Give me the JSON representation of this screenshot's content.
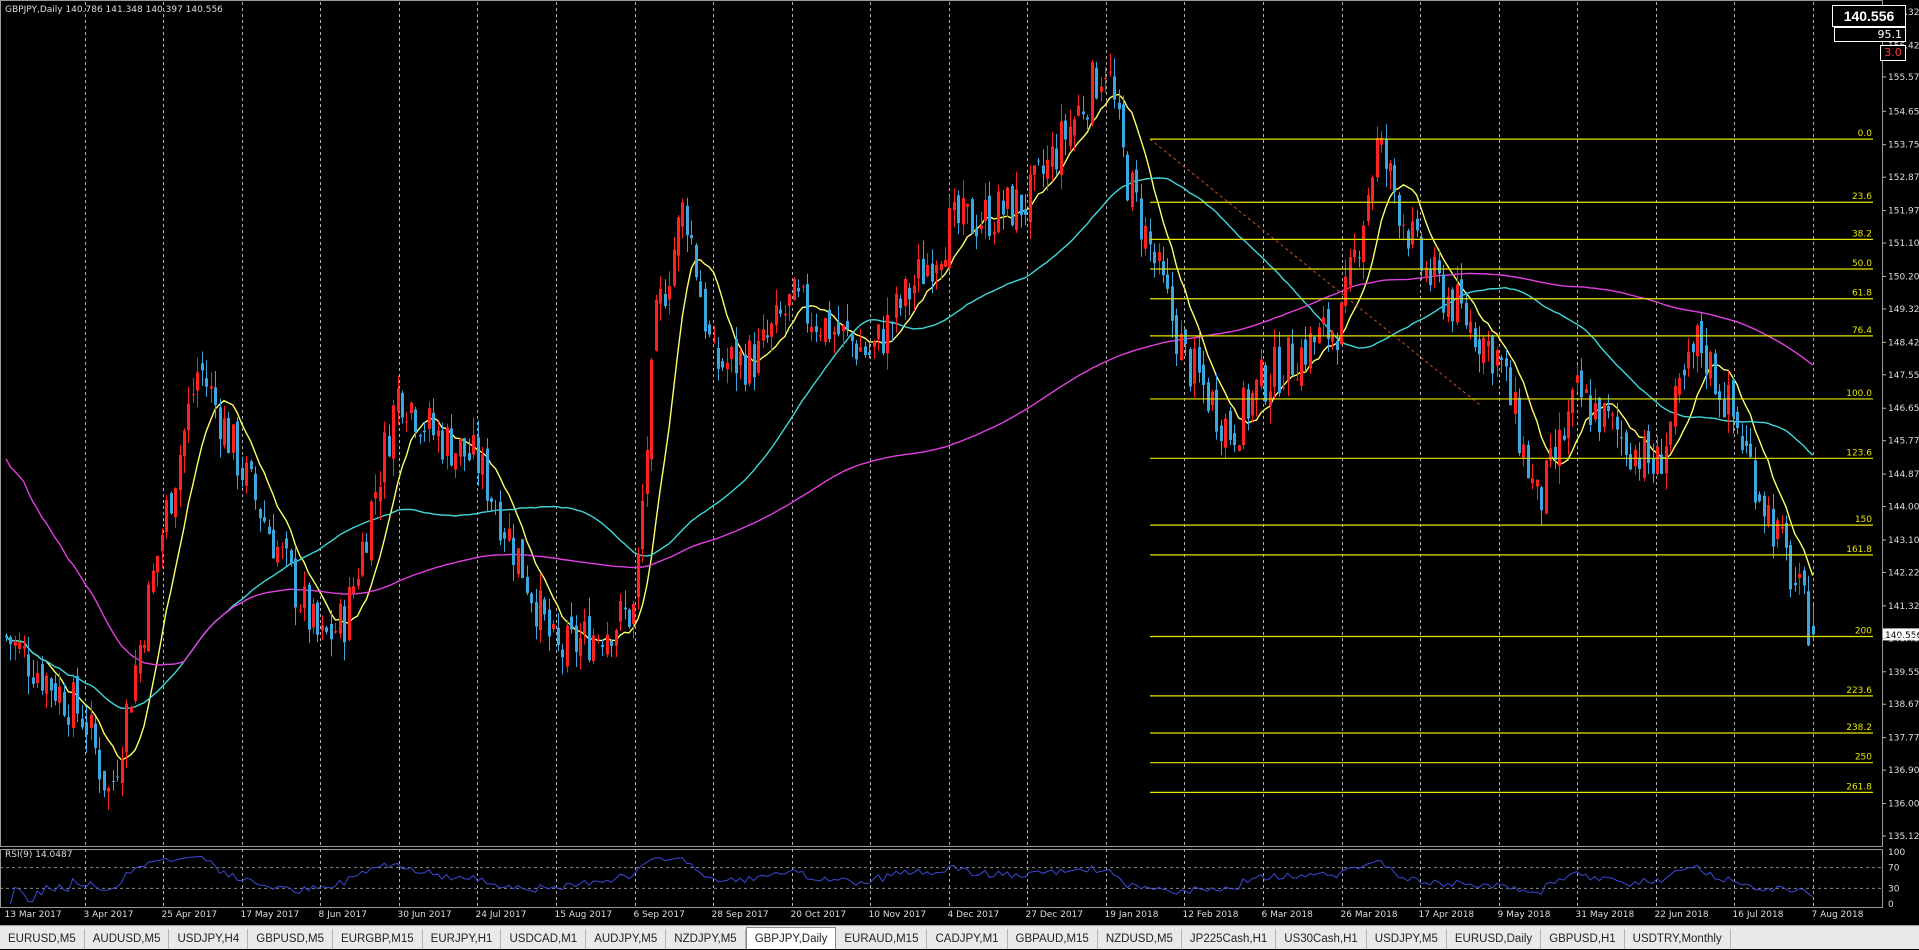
{
  "chart_header": {
    "text": "GBPJPY,Daily  140.786 141.348 140.397 140.556"
  },
  "rsi_header": {
    "text": "RSI(9) 14.0487"
  },
  "price_box": {
    "bid": "140.556",
    "spread": "95.1",
    "drawdown": "3.0"
  },
  "tabs": [
    {
      "label": "EURUSD,M5"
    },
    {
      "label": "AUDUSD,M5"
    },
    {
      "label": "USDJPY,H4"
    },
    {
      "label": "GBPUSD,M5"
    },
    {
      "label": "EURGBP,M15"
    },
    {
      "label": "EURJPY,H1"
    },
    {
      "label": "USDCAD,M1"
    },
    {
      "label": "AUDJPY,M5"
    },
    {
      "label": "NZDJPY,M5"
    },
    {
      "label": "GBPJPY,Daily",
      "active": true
    },
    {
      "label": "EURAUD,M15"
    },
    {
      "label": "CADJPY,M1"
    },
    {
      "label": "GBPAUD,M15"
    },
    {
      "label": "NZDUSD,M5"
    },
    {
      "label": "JP225Cash,H1"
    },
    {
      "label": "US30Cash,H1"
    },
    {
      "label": "USDJPY,M5"
    },
    {
      "label": "EURUSD,Daily"
    },
    {
      "label": "GBPUSD,H1"
    },
    {
      "label": "USDTRY,Monthly"
    }
  ],
  "chart_data": {
    "type": "candlestick",
    "symbol": "GBPJPY",
    "timeframe": "Daily",
    "open": 140.786,
    "high": 141.348,
    "low": 140.397,
    "close": 140.556,
    "ylim": [
      135.125,
      157.325
    ],
    "price_ticks": [
      "157.325",
      "156.425",
      "155.575",
      "154.650",
      "153.750",
      "152.875",
      "151.975",
      "151.100",
      "150.200",
      "149.325",
      "148.425",
      "147.550",
      "146.650",
      "145.775",
      "144.875",
      "144.000",
      "143.100",
      "142.225",
      "141.325",
      "140.450",
      "139.550",
      "138.675",
      "137.775",
      "136.900",
      "136.000",
      "135.125"
    ],
    "date_ticks": [
      "13 Mar 2017",
      "3 Apr 2017",
      "25 Apr 2017",
      "17 May 2017",
      "8 Jun 2017",
      "30 Jun 2017",
      "24 Jul 2017",
      "15 Aug 2017",
      "6 Sep 2017",
      "28 Sep 2017",
      "20 Oct 2017",
      "10 Nov 2017",
      "4 Dec 2017",
      "27 Dec 2017",
      "19 Jan 2018",
      "12 Feb 2018",
      "6 Mar 2018",
      "26 Mar 2018",
      "17 Apr 2018",
      "9 May 2018",
      "31 May 2018",
      "22 Jun 2018",
      "16 Jul 2018",
      "7 Aug 2018"
    ],
    "close_path": [
      [
        "13 Mar 2017",
        140.5
      ],
      [
        "3 Apr 2017",
        138.3
      ],
      [
        "10 Apr 2017",
        136.2
      ],
      [
        "25 Apr 2017",
        143.5
      ],
      [
        "5 May 2017",
        147.8
      ],
      [
        "17 May 2017",
        145.0
      ],
      [
        "8 Jun 2017",
        140.3
      ],
      [
        "15 Jun 2017",
        141.0
      ],
      [
        "30 Jun 2017",
        147.2
      ],
      [
        "10 Jul 2017",
        146.0
      ],
      [
        "24 Jul 2017",
        145.2
      ],
      [
        "5 Aug 2017",
        142.5
      ],
      [
        "15 Aug 2017",
        140.0
      ],
      [
        "6 Sep 2017",
        141.2
      ],
      [
        "12 Sep 2017",
        149.0
      ],
      [
        "20 Sep 2017",
        152.2
      ],
      [
        "28 Sep 2017",
        147.8
      ],
      [
        "10 Oct 2017",
        148.0
      ],
      [
        "20 Oct 2017",
        149.5
      ],
      [
        "10 Nov 2017",
        148.1
      ],
      [
        "4 Dec 2017",
        151.5
      ],
      [
        "27 Dec 2017",
        152.2
      ],
      [
        "19 Jan 2018",
        156.0
      ],
      [
        "25 Jan 2018",
        153.0
      ],
      [
        "12 Feb 2018",
        148.0
      ],
      [
        "25 Feb 2018",
        146.0
      ],
      [
        "6 Mar 2018",
        147.4
      ],
      [
        "26 Mar 2018",
        149.0
      ],
      [
        "5 Apr 2018",
        153.8
      ],
      [
        "17 Apr 2018",
        150.5
      ],
      [
        "9 May 2018",
        148.0
      ],
      [
        "20 May 2018",
        144.0
      ],
      [
        "31 May 2018",
        147.0
      ],
      [
        "22 Jun 2018",
        145.0
      ],
      [
        "5 Jul 2018",
        148.5
      ],
      [
        "16 Jul 2018",
        146.3
      ],
      [
        "7 Aug 2018",
        140.556
      ]
    ],
    "fibonacci_levels": [
      {
        "label": "0.0",
        "price": 153.9
      },
      {
        "label": "23.6",
        "price": 152.2
      },
      {
        "label": "38.2",
        "price": 151.2
      },
      {
        "label": "50.0",
        "price": 150.4
      },
      {
        "label": "61.8",
        "price": 149.6
      },
      {
        "label": "76.4",
        "price": 148.6
      },
      {
        "label": "100.0",
        "price": 146.9
      },
      {
        "label": "123.6",
        "price": 145.3
      },
      {
        "label": "150",
        "price": 143.5
      },
      {
        "label": "161.8",
        "price": 142.7
      },
      {
        "label": "200",
        "price": 140.5
      },
      {
        "label": "223.6",
        "price": 138.9
      },
      {
        "label": "238.2",
        "price": 137.9
      },
      {
        "label": "250",
        "price": 137.1
      },
      {
        "label": "261.8",
        "price": 136.3
      }
    ],
    "fib_label_price": "140.556",
    "rsi": {
      "period": 9,
      "value": 14.0487,
      "levels": [
        "100",
        "70",
        "30",
        "0"
      ]
    },
    "colors": {
      "bull": "#ff2020",
      "bear": "#3aa8e0",
      "ma_fast": "#ffff66",
      "ma_mid": "#40d8d8",
      "ma_slow": "#e040e0",
      "fib": "#e6e600",
      "rsi": "#3a4ad8",
      "grid": "#ffffff"
    },
    "grid": true
  }
}
